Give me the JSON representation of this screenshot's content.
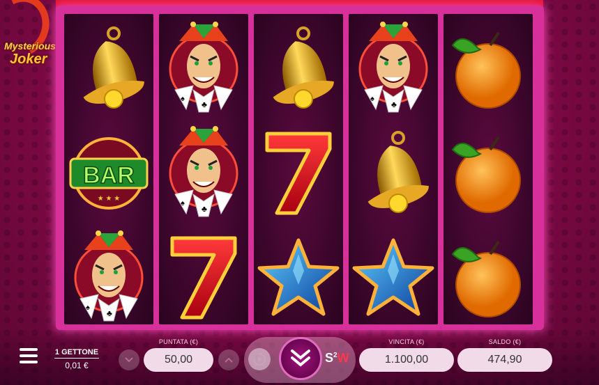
{
  "game": {
    "logo_line1": "Mysterious",
    "logo_line2": "Joker"
  },
  "reels": [
    [
      "bell",
      "bar",
      "joker"
    ],
    [
      "joker",
      "joker",
      "seven"
    ],
    [
      "bell",
      "seven",
      "star"
    ],
    [
      "joker",
      "bell",
      "star"
    ],
    [
      "orange",
      "orange",
      "orange"
    ]
  ],
  "symbols": {
    "bar_text": "BAR"
  },
  "controls": {
    "coin_label": "1 GETTONE",
    "coin_value": "0,01 €",
    "bet_label": "PUNTATA (€)",
    "bet_value": "50,00",
    "win_label": "VINCITA (€)",
    "win_value": "1.100,00",
    "balance_label": "SALDO (€)",
    "balance_value": "474,90",
    "s2w_s": "S",
    "s2w_sup": "2",
    "s2w_w": "W"
  },
  "colors": {
    "frame": "#d8309a",
    "accent": "#ff4fc0",
    "background": "#8a0a4a"
  }
}
